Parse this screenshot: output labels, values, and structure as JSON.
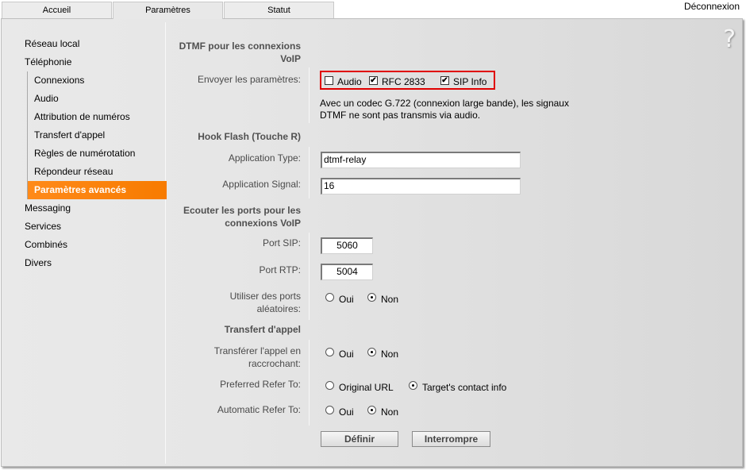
{
  "tabs": [
    {
      "label": "Accueil",
      "active": false
    },
    {
      "label": "Paramètres",
      "active": true
    },
    {
      "label": "Statut",
      "active": false
    }
  ],
  "header": {
    "logout_label": "Déconnexion",
    "help_icon": "?"
  },
  "sidebar": {
    "items": [
      {
        "label": "Réseau local"
      },
      {
        "label": "Téléphonie"
      },
      {
        "label": "Messaging"
      },
      {
        "label": "Services"
      },
      {
        "label": "Combinés"
      },
      {
        "label": "Divers"
      }
    ],
    "telephonie_sub": [
      {
        "label": "Connexions"
      },
      {
        "label": "Audio"
      },
      {
        "label": "Attribution de numéros"
      },
      {
        "label": "Transfert d'appel"
      },
      {
        "label": "Règles de numérotation"
      },
      {
        "label": "Répondeur réseau"
      },
      {
        "label": "Paramètres avancés",
        "active": true
      }
    ]
  },
  "form": {
    "dtmf": {
      "title": "DTMF pour les connexions VoIP",
      "send_label": "Envoyer les paramètres:",
      "options": [
        {
          "label": "Audio",
          "checked": false
        },
        {
          "label": "RFC 2833",
          "checked": true
        },
        {
          "label": "SIP Info",
          "checked": true
        }
      ],
      "note_line1": "Avec un codec G.722 (connexion large bande), les signaux",
      "note_line2": "DTMF ne sont pas transmis via audio."
    },
    "hookflash": {
      "title": "Hook Flash (Touche R)",
      "app_type_label": "Application Type:",
      "app_type_value": "dtmf-relay",
      "app_signal_label": "Application Signal:",
      "app_signal_value": "16"
    },
    "ports": {
      "title_line1": "Ecouter les ports pour les",
      "title_line2": "connexions VoIP",
      "sip_label": "Port SIP:",
      "sip_value": "5060",
      "rtp_label": "Port RTP:",
      "rtp_value": "5004",
      "random_label_line1": "Utiliser des ports",
      "random_label_line2": "aléatoires:",
      "random_options": [
        {
          "label": "Oui",
          "selected": false
        },
        {
          "label": "Non",
          "selected": true
        }
      ]
    },
    "transfer": {
      "title": "Transfert d'appel",
      "hangup_label_line1": "Transférer l'appel en",
      "hangup_label_line2": "raccrochant:",
      "hangup_options": [
        {
          "label": "Oui",
          "selected": false
        },
        {
          "label": "Non",
          "selected": true
        }
      ],
      "preferred_label": "Preferred Refer To:",
      "preferred_options": [
        {
          "label": "Original URL",
          "selected": false
        },
        {
          "label": "Target's contact info",
          "selected": true
        }
      ],
      "automatic_label": "Automatic Refer To:",
      "automatic_options": [
        {
          "label": "Oui",
          "selected": false
        },
        {
          "label": "Non",
          "selected": true
        }
      ]
    },
    "buttons": {
      "submit": "Définir",
      "cancel": "Interrompre"
    }
  }
}
